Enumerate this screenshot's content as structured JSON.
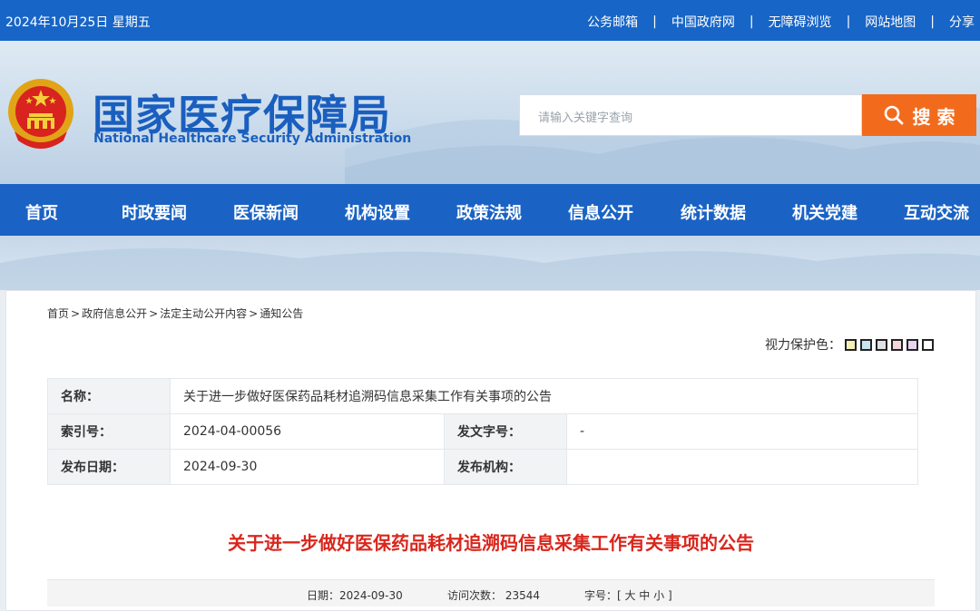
{
  "topbar": {
    "date": "2024年10月25日 星期五",
    "links": [
      "公务邮箱",
      "中国政府网",
      "无障碍浏览",
      "网站地图",
      "分享"
    ],
    "separator": "|"
  },
  "header": {
    "logo_cn": "国家医疗保障局",
    "logo_en": "National Healthcare Security Administration",
    "search_placeholder": "请输入关键字查询",
    "search_button": "搜 索",
    "search_icon": "search-icon"
  },
  "nav": [
    "首页",
    "时政要闻",
    "医保新闻",
    "机构设置",
    "政策法规",
    "信息公开",
    "统计数据",
    "机关党建",
    "互动交流"
  ],
  "breadcrumb": [
    "首页",
    "政府信息公开",
    "法定主动公开内容",
    "通知公告"
  ],
  "breadcrumb_sep": ">",
  "eye_care": {
    "label": "视力保护色：",
    "colors": [
      "#f5f0b3",
      "#c6e4f2",
      "#dfe3e8",
      "#f4d6dc",
      "#e7d6f1",
      "#ffffff"
    ]
  },
  "meta": {
    "name_label": "名称：",
    "name_value": "关于进一步做好医保药品耗材追溯码信息采集工作有关事项的公告",
    "index_label": "索引号：",
    "index_value": "2024-04-00056",
    "docno_label": "发文字号：",
    "docno_value": "-",
    "date_label": "发布日期：",
    "date_value": "2024-09-30",
    "org_label": "发布机构：",
    "org_value": ""
  },
  "doc_title": "关于进一步做好医保药品耗材追溯码信息采集工作有关事项的公告",
  "infobar": {
    "date": "日期：2024-09-30",
    "visits": "访问次数： 23544",
    "fontsize": "字号：[ 大 中 小 ]"
  },
  "colors": {
    "brand_blue": "#1a63c4",
    "search_orange": "#f26b1d",
    "title_red": "#d9261c"
  }
}
